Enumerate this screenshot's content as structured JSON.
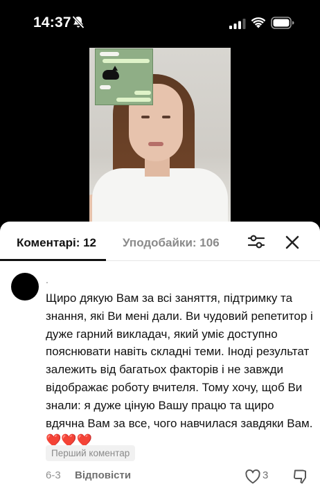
{
  "status_bar": {
    "time": "14:37"
  },
  "icons": {
    "mute": "bell-slash-icon",
    "signal": "cellular-signal-icon",
    "wifi": "wifi-icon",
    "battery": "battery-icon",
    "filter": "filter-sliders-icon",
    "close": "close-icon",
    "like": "heart-outline-icon",
    "dislike": "thumbs-down-icon"
  },
  "sheet": {
    "tabs": [
      {
        "label": "Коментарі: 12",
        "active": true
      },
      {
        "label": "Уподобайки: 106",
        "active": false
      }
    ]
  },
  "comment": {
    "username": ".",
    "text": "Щиро дякую Вам за всі заняття, підтримку та знання, які Ви мені дали. Ви чудовий репетитор і дуже гарний викладач, який уміє доступно пояснювати навіть складні теми. Іноді результат залежить від багатьох факторів і не завжди відображає роботу вчителя. Тому хочу, щоб Ви знали: я дуже ціную Вашу працю та щиро вдячна Вам за все, чого навчилася завдяки Вам.",
    "hearts": "❤️❤️❤️",
    "badge": "Перший коментар",
    "date": "6-3",
    "reply_label": "Відповісти",
    "like_count": "3"
  },
  "colors": {
    "accent_heart": "#e0261e",
    "tab_active": "#111111",
    "tab_inactive": "#8a8a8a"
  }
}
